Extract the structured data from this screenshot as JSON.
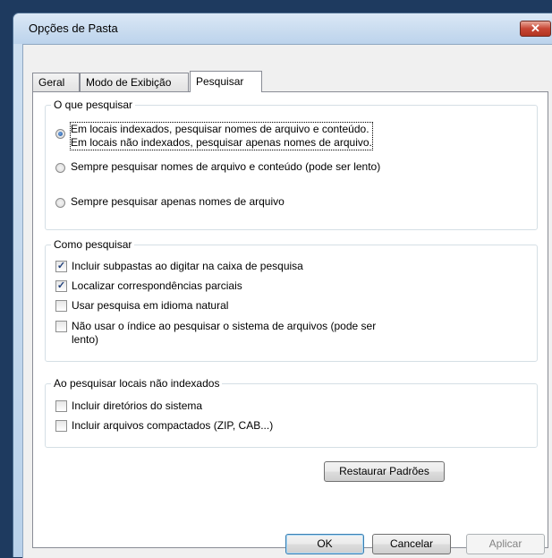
{
  "window": {
    "title": "Opções de Pasta",
    "close_glyph": "✕"
  },
  "tabs": [
    {
      "label": "Geral",
      "active": false
    },
    {
      "label": "Modo de Exibição",
      "active": false
    },
    {
      "label": "Pesquisar",
      "active": true
    }
  ],
  "what_to_search": {
    "title": "O que pesquisar",
    "options": [
      {
        "line1": "Em locais indexados, pesquisar nomes de arquivo e conteúdo.",
        "line2": "Em locais não indexados, pesquisar apenas nomes de arquivo.",
        "checked": true
      },
      {
        "label": "Sempre pesquisar nomes de arquivo e conteúdo (pode ser lento)",
        "checked": false
      },
      {
        "label": "Sempre pesquisar apenas nomes de arquivo",
        "checked": false
      }
    ]
  },
  "how_to_search": {
    "title": "Como pesquisar",
    "options": [
      {
        "label": "Incluir subpastas ao digitar na caixa de pesquisa",
        "checked": true
      },
      {
        "label": "Localizar correspondências parciais",
        "checked": true
      },
      {
        "label": "Usar pesquisa em idioma natural",
        "checked": false
      },
      {
        "label": "Não usar o índice ao pesquisar o sistema de arquivos (pode ser lento)",
        "checked": false
      }
    ]
  },
  "non_indexed": {
    "title": "Ao pesquisar locais não indexados",
    "options": [
      {
        "label": "Incluir diretórios do sistema",
        "checked": false
      },
      {
        "label": "Incluir arquivos compactados (ZIP, CAB...)",
        "checked": false
      }
    ]
  },
  "buttons": {
    "restore": "Restaurar Padrões",
    "ok": "OK",
    "cancel": "Cancelar",
    "apply": "Aplicar"
  },
  "check_glyph": "✓"
}
